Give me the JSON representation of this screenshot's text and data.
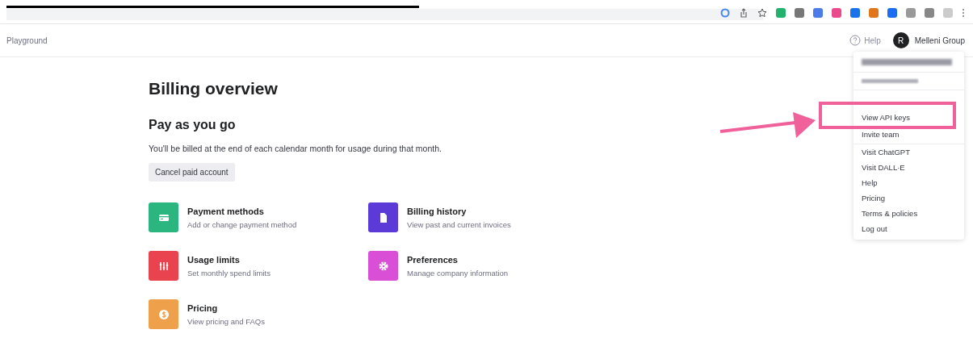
{
  "header": {
    "title": "Playground",
    "help": "Help",
    "avatar": "R",
    "org": "Melleni Group"
  },
  "page": {
    "title": "Billing overview",
    "plan": "Pay as you go",
    "description": "You'll be billed at the end of each calendar month for usage during that month.",
    "cancel_button": "Cancel paid account"
  },
  "cards": [
    {
      "kind": "card",
      "title": "Payment methods",
      "subtitle": "Add or change payment method",
      "color": "#2bb57f"
    },
    {
      "kind": "document",
      "title": "Billing history",
      "subtitle": "View past and current invoices",
      "color": "#5b3ad8"
    },
    {
      "kind": "sliders",
      "title": "Usage limits",
      "subtitle": "Set monthly spend limits",
      "color": "#e8434f"
    },
    {
      "kind": "gear",
      "title": "Preferences",
      "subtitle": "Manage company information",
      "color": "#d94fd6"
    },
    {
      "kind": "dollar",
      "title": "Pricing",
      "subtitle": "View pricing and FAQs",
      "color": "#eea04a"
    }
  ],
  "menu": {
    "highlighted": "View API keys",
    "account_items": [
      "Invite team"
    ],
    "items": [
      "Visit ChatGPT",
      "Visit DALL·E",
      "Help",
      "Pricing",
      "Terms & policies",
      "Log out"
    ]
  }
}
